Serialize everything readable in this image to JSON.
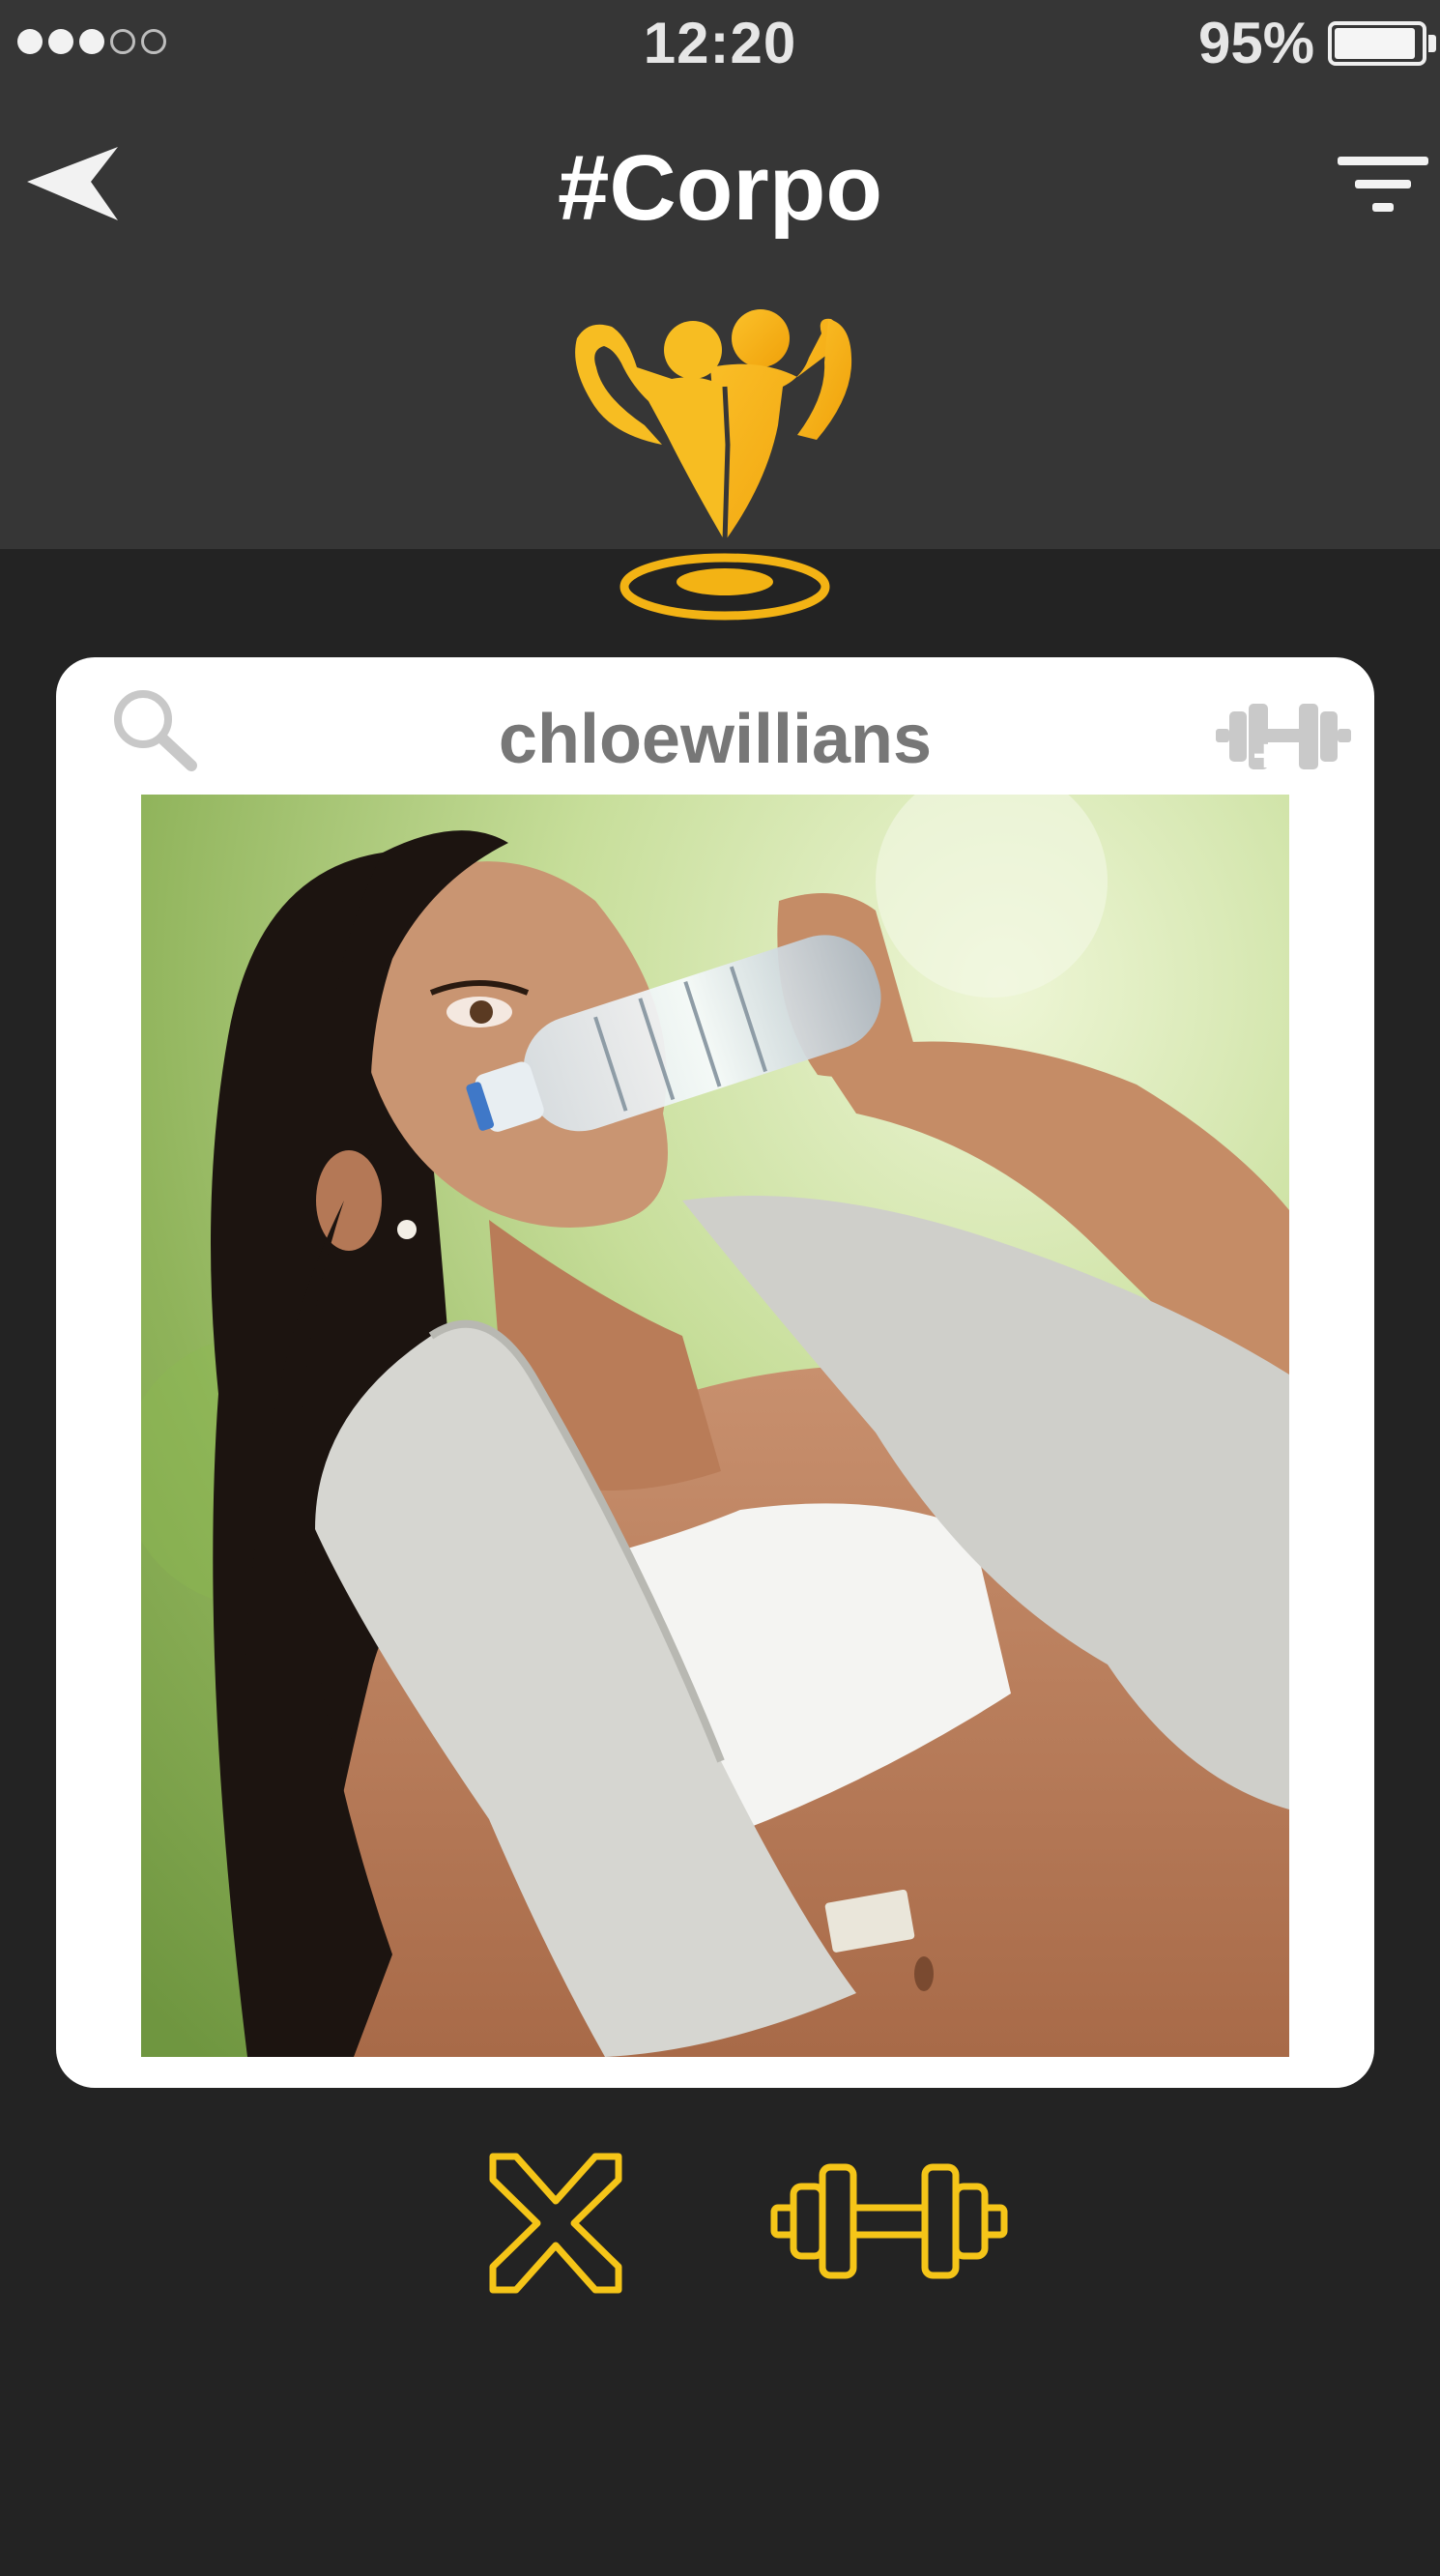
{
  "status_bar": {
    "signal_bars_filled": 3,
    "signal_bars_total": 5,
    "time": "12:20",
    "battery_percent_label": "95%",
    "battery_level": 0.95
  },
  "nav": {
    "title": "#Corpo",
    "back_icon": "back-arrow-icon",
    "filter_icon": "filter-icon"
  },
  "logo": {
    "icon": "bodybuilders-logo-icon",
    "color": "#f5b316"
  },
  "card": {
    "username": "chloewillians",
    "search_icon": "search-icon",
    "dumbbell_icon": "dumbbell-icon",
    "photo": "profile-photo"
  },
  "actions": {
    "reject_icon": "x-icon",
    "like_icon": "dumbbell-icon",
    "accent_color": "#f5c518"
  }
}
